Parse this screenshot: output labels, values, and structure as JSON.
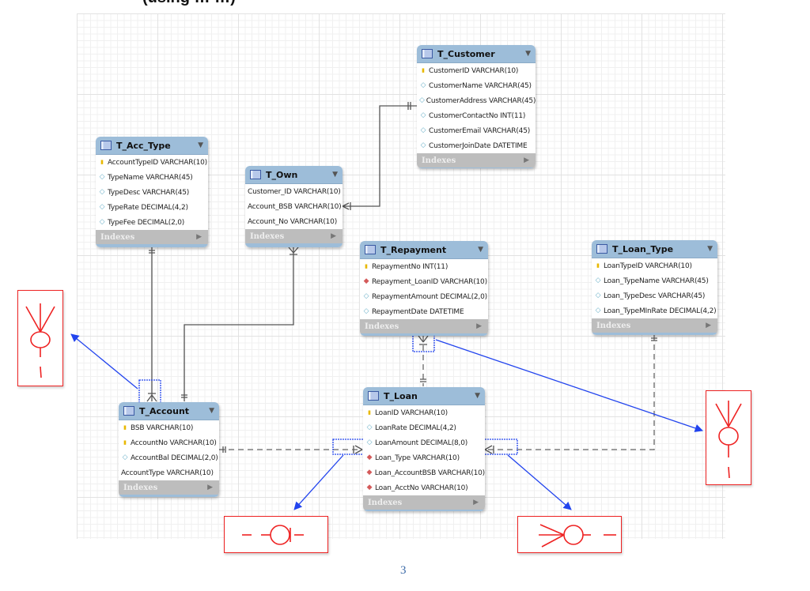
{
  "page": {
    "title_partial": "(using … …)",
    "page_number": "3"
  },
  "tables": {
    "customer": {
      "name": "T_Customer",
      "columns": [
        {
          "key": "pk",
          "text": "CustomerID VARCHAR(10)"
        },
        {
          "key": "col",
          "text": "CustomerName VARCHAR(45)"
        },
        {
          "key": "col",
          "text": "CustomerAddress VARCHAR(45)"
        },
        {
          "key": "col",
          "text": "CustomerContactNo INT(11)"
        },
        {
          "key": "col",
          "text": "CustomerEmail VARCHAR(45)"
        },
        {
          "key": "col",
          "text": "CustomerJoinDate DATETIME"
        }
      ],
      "indexes_label": "Indexes"
    },
    "acc_type": {
      "name": "T_Acc_Type",
      "columns": [
        {
          "key": "pk",
          "text": "AccountTypeID VARCHAR(10)"
        },
        {
          "key": "col",
          "text": "TypeName VARCHAR(45)"
        },
        {
          "key": "col",
          "text": "TypeDesc VARCHAR(45)"
        },
        {
          "key": "col",
          "text": "TypeRate DECIMAL(4,2)"
        },
        {
          "key": "col",
          "text": "TypeFee DECIMAL(2,0)"
        }
      ],
      "indexes_label": "Indexes"
    },
    "own": {
      "name": "T_Own",
      "columns": [
        {
          "key": "none",
          "text": "Customer_ID VARCHAR(10)"
        },
        {
          "key": "none",
          "text": "Account_BSB VARCHAR(10)"
        },
        {
          "key": "none",
          "text": "Account_No VARCHAR(10)"
        }
      ],
      "indexes_label": "Indexes"
    },
    "repayment": {
      "name": "T_Repayment",
      "columns": [
        {
          "key": "pk",
          "text": "RepaymentNo INT(11)"
        },
        {
          "key": "fk",
          "text": "Repayment_LoanID VARCHAR(10)"
        },
        {
          "key": "col",
          "text": "RepaymentAmount DECIMAL(2,0)"
        },
        {
          "key": "col",
          "text": "RepaymentDate DATETIME"
        }
      ],
      "indexes_label": "Indexes"
    },
    "loan_type": {
      "name": "T_Loan_Type",
      "columns": [
        {
          "key": "pk",
          "text": "LoanTypeID VARCHAR(10)"
        },
        {
          "key": "col",
          "text": "Loan_TypeName VARCHAR(45)"
        },
        {
          "key": "col",
          "text": "Loan_TypeDesc VARCHAR(45)"
        },
        {
          "key": "col",
          "text": "Loan_TypeMInRate DECIMAL(4,2)"
        }
      ],
      "indexes_label": "Indexes"
    },
    "account": {
      "name": "T_Account",
      "columns": [
        {
          "key": "pk",
          "text": "BSB VARCHAR(10)"
        },
        {
          "key": "pk",
          "text": "AccountNo VARCHAR(10)"
        },
        {
          "key": "col",
          "text": "AccountBal DECIMAL(2,0)"
        },
        {
          "key": "none",
          "text": "AccountType VARCHAR(10)"
        }
      ],
      "indexes_label": "Indexes"
    },
    "loan": {
      "name": "T_Loan",
      "columns": [
        {
          "key": "pk",
          "text": "LoanID VARCHAR(10)"
        },
        {
          "key": "col",
          "text": "LoanRate DECIMAL(4,2)"
        },
        {
          "key": "col",
          "text": "LoanAmount DECIMAL(8,0)"
        },
        {
          "key": "fk",
          "text": "Loan_Type VARCHAR(10)"
        },
        {
          "key": "fk",
          "text": "Loan_AccountBSB VARCHAR(10)"
        },
        {
          "key": "fk",
          "text": "Loan_AcctNo VARCHAR(10)"
        }
      ],
      "indexes_label": "Indexes"
    }
  },
  "relationships": [
    {
      "from": "T_Customer",
      "to": "T_Own",
      "style": "solid",
      "from_end": "one-mandatory",
      "to_end": "many-mandatory"
    },
    {
      "from": "T_Acc_Type",
      "to": "T_Account",
      "style": "solid",
      "from_end": "one-mandatory",
      "to_end": "many-mandatory"
    },
    {
      "from": "T_Own",
      "to": "T_Account",
      "style": "solid",
      "from_end": "many-mandatory",
      "to_end": "one-mandatory"
    },
    {
      "from": "T_Account",
      "to": "T_Loan",
      "style": "dashed",
      "from_end": "one-mandatory",
      "to_end": "many-mandatory"
    },
    {
      "from": "T_Repayment",
      "to": "T_Loan",
      "style": "dashed",
      "from_end": "many-mandatory",
      "to_end": "one-mandatory"
    },
    {
      "from": "T_Loan_Type",
      "to": "T_Loan",
      "style": "dashed",
      "from_end": "one-mandatory",
      "to_end": "many-mandatory"
    }
  ],
  "annotations": {
    "color_box": "#ee2222",
    "color_arrow": "#2244ee",
    "items": [
      {
        "name": "account-acctype-notation",
        "symbol": "crow's foot + circle + bar (vertical)"
      },
      {
        "name": "repayment-notation",
        "symbol": "crow's foot + circle + bar (vertical)"
      },
      {
        "name": "account-loan-notation",
        "symbol": "bar + circle + bar (horizontal)"
      },
      {
        "name": "loan-loantype-notation",
        "symbol": "crow's foot + circle + bar (horizontal)"
      }
    ]
  },
  "colors": {
    "table_header": "#9dbdd9",
    "indexes_bar": "#bdbdbd",
    "pk_icon": "#e8b800",
    "fk_icon": "#d45a5a",
    "column_icon": "#6ab0c8",
    "page_number": "#3b6aa8"
  }
}
